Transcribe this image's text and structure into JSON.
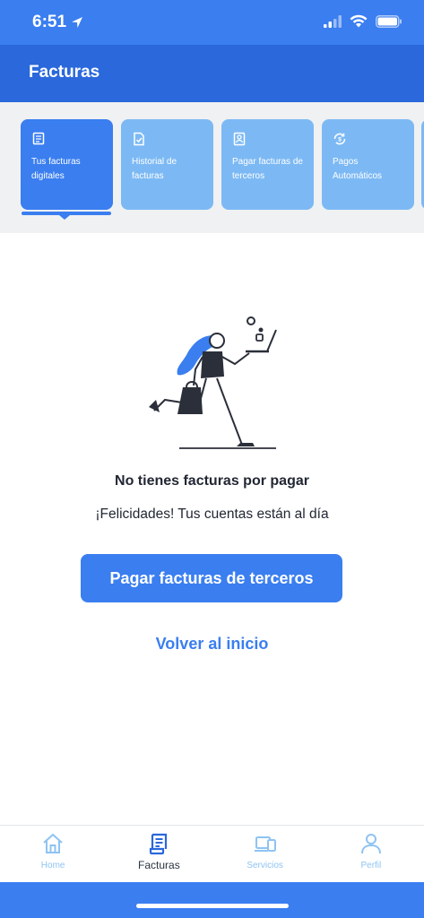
{
  "status_bar": {
    "time": "6:51"
  },
  "header": {
    "title": "Facturas"
  },
  "tabs": [
    {
      "label": "Tus facturas digitales",
      "icon": "receipt-icon",
      "active": true
    },
    {
      "label": "Historial de facturas",
      "icon": "document-check-icon",
      "active": false
    },
    {
      "label": "Pagar facturas de terceros",
      "icon": "person-document-icon",
      "active": false
    },
    {
      "label": "Pagos Automáticos",
      "icon": "auto-payment-icon",
      "active": false
    }
  ],
  "empty_state": {
    "title": "No tienes facturas por pagar",
    "subtitle": "¡Felicidades! Tus cuentas están al día",
    "primary_button": "Pagar facturas de terceros",
    "link": "Volver al inicio"
  },
  "bottom_nav": [
    {
      "label": "Home",
      "icon": "home-icon",
      "active": false
    },
    {
      "label": "Facturas",
      "icon": "invoice-icon",
      "active": true
    },
    {
      "label": "Servicios",
      "icon": "devices-icon",
      "active": false
    },
    {
      "label": "Perfil",
      "icon": "user-icon",
      "active": false
    }
  ],
  "colors": {
    "primary": "#3a7ef0",
    "header": "#2a68dc",
    "tab_inactive": "#7cb9f4",
    "nav_inactive": "#8ec3f3"
  }
}
